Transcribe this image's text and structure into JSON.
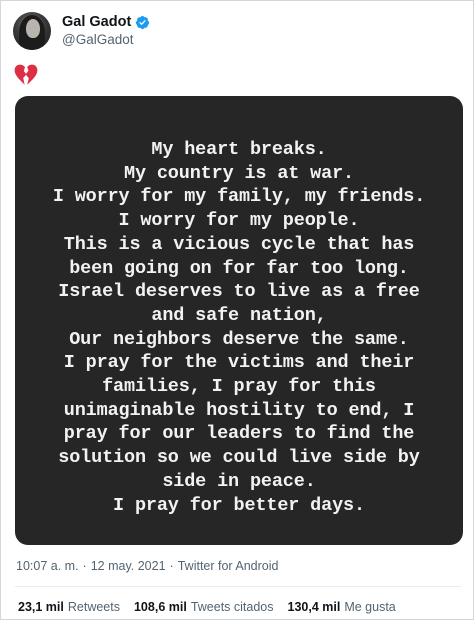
{
  "author": {
    "name": "Gal Gadot",
    "handle": "@GalGadot",
    "verified_icon": "verified-badge-icon",
    "avatar_icon": "profile-photo"
  },
  "tweet": {
    "emoji": "broken-heart-icon",
    "image_lines": [
      "My heart breaks.",
      "My country is at war.",
      "I worry for my family, my friends.",
      "I worry for my people.",
      "This is a vicious cycle that has",
      "been going on for far too long.",
      "Israel deserves to live as a free",
      "and safe nation,",
      "Our neighbors deserve the same.",
      "I pray for the victims and their",
      "families, I pray for this",
      "unimaginable hostility to end, I",
      "pray for our leaders to find the",
      "solution so we could live side by",
      "side in peace.",
      "I pray for better days."
    ]
  },
  "meta": {
    "time": "10:07 a. m.",
    "separator": "·",
    "date": "12 may. 2021",
    "source": "Twitter for Android"
  },
  "stats": {
    "retweets_count": "23,1 mil",
    "retweets_label": "Retweets",
    "quotes_count": "108,6 mil",
    "quotes_label": "Tweets citados",
    "likes_count": "130,4 mil",
    "likes_label": "Me gusta"
  },
  "colors": {
    "verified_blue": "#1d9bf0",
    "broken_heart_red": "#dd2e44",
    "image_background": "#262626",
    "secondary_text": "#536471"
  }
}
